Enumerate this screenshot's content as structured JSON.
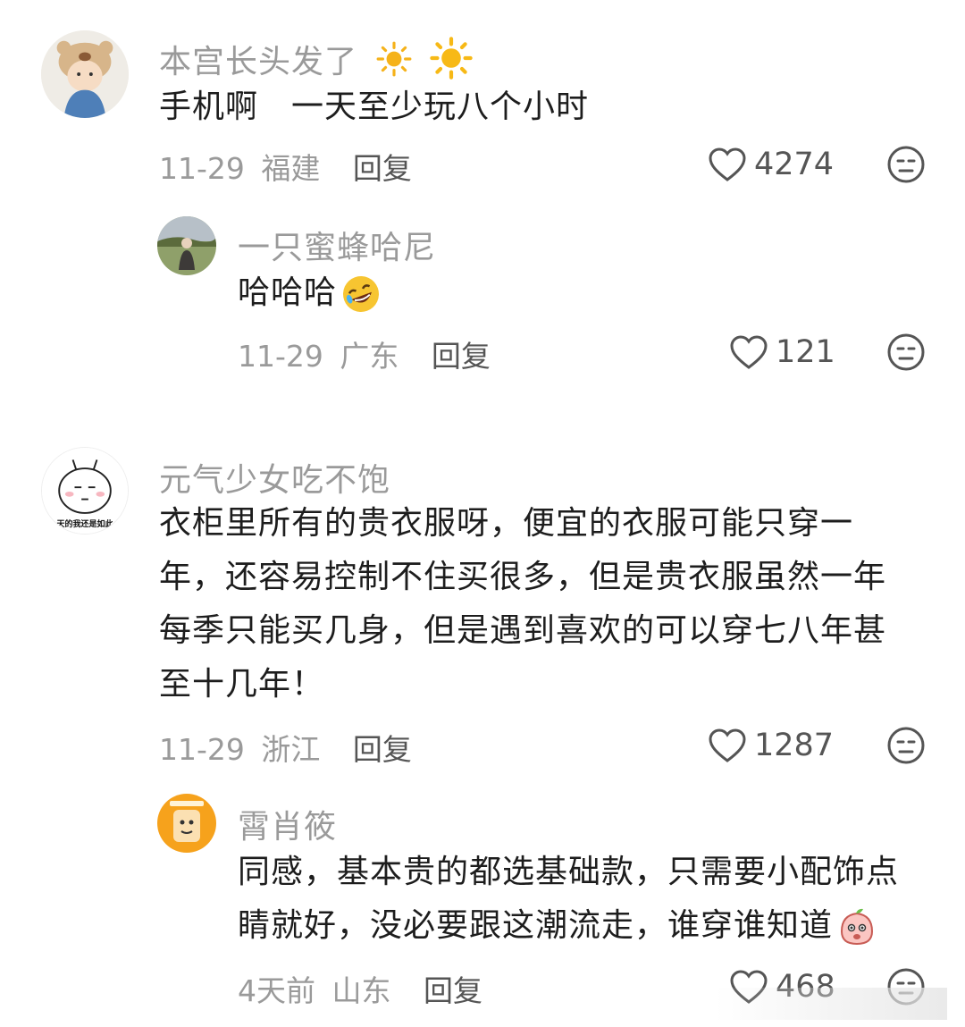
{
  "comments": [
    {
      "username": "本宫长头发了",
      "user_emoji": "sun-icon",
      "text": "手机啊　一天至少玩八个小时",
      "date": "11-29",
      "location": "福建",
      "reply_label": "回复",
      "likes": "4274",
      "replies": [
        {
          "username": "一只蜜蜂哈尼",
          "text": "哈哈哈",
          "text_emoji": "rofl-emoji",
          "date": "11-29",
          "location": "广东",
          "reply_label": "回复",
          "likes": "121"
        }
      ]
    },
    {
      "username": "元气少女吃不饱",
      "avatar_caption": "天的我还是如此",
      "text_lines": [
        "衣柜里所有的贵衣服呀，便宜的衣服可能只穿一",
        "年，还容易控制不住买很多，但是贵衣服虽然一年",
        "每季只能买几身，但是遇到喜欢的可以穿七八年甚",
        "至十几年！"
      ],
      "date": "11-29",
      "location": "浙江",
      "reply_label": "回复",
      "likes": "1287",
      "replies": [
        {
          "username": "霄肖筱",
          "text_lines": [
            "同感，基本贵的都选基础款，只需要小配饰点",
            "睛就好，没必要跟这潮流走，谁穿谁知道"
          ],
          "text_emoji": "peach-emoji",
          "date": "4天前",
          "location": "山东",
          "reply_label": "回复",
          "likes": "468"
        }
      ]
    }
  ],
  "colors": {
    "username": "#9a9a9a",
    "text": "#1d1d1d",
    "meta": "#9a9a9a",
    "action": "#555555",
    "sun": "#f5b21a"
  }
}
